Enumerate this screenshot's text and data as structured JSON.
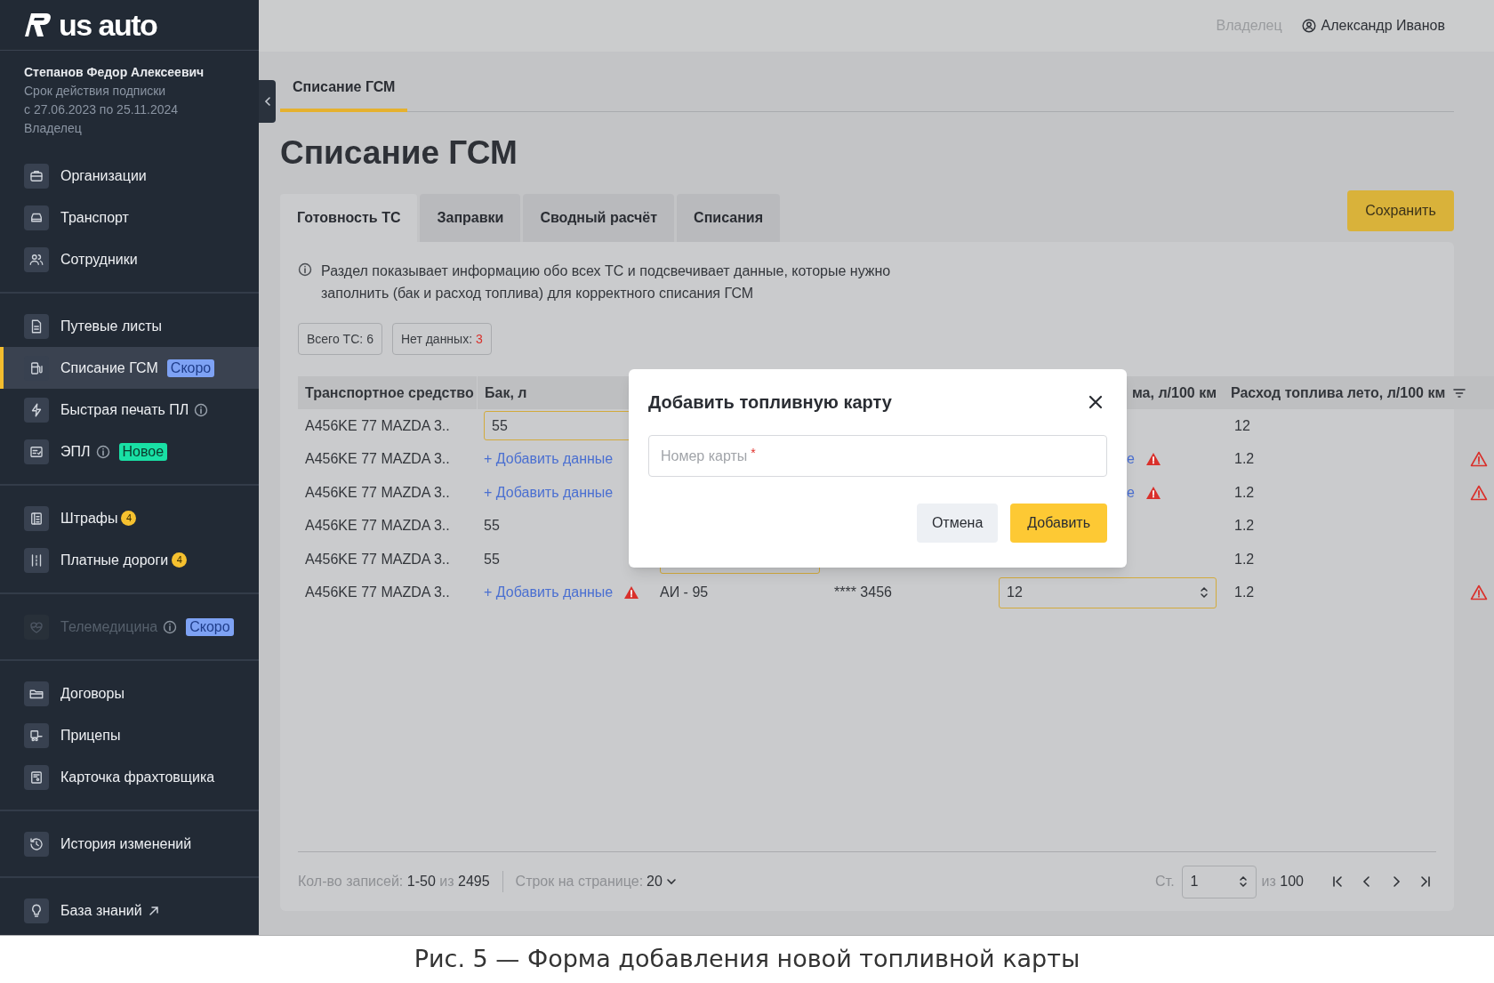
{
  "logo": {
    "text": "us auto"
  },
  "profile": {
    "name": "Степанов Федор Алексеевич",
    "subscription_label": "Срок действия подписки",
    "subscription_period": "с 27.06.2023 по 25.11.2024",
    "role": "Владелец"
  },
  "nav": [
    {
      "items": [
        {
          "label": "Организации",
          "selected": false,
          "disabled": false
        },
        {
          "label": "Транспорт",
          "selected": false,
          "disabled": false
        },
        {
          "label": "Сотрудники",
          "selected": false,
          "disabled": false
        }
      ]
    },
    {
      "items": [
        {
          "label": "Путевые листы",
          "selected": false,
          "disabled": false
        },
        {
          "label": "Списание ГСМ",
          "selected": true,
          "disabled": false,
          "badge": {
            "kind": "soon",
            "text": "Скоро"
          }
        },
        {
          "label": "Быстрая печать ПЛ",
          "selected": false,
          "disabled": false,
          "info": true
        },
        {
          "label": "ЭПЛ",
          "selected": false,
          "disabled": false,
          "info": true,
          "badge": {
            "kind": "new",
            "text": "Новое"
          }
        }
      ]
    },
    {
      "items": [
        {
          "label": "Штрафы",
          "selected": false,
          "disabled": false,
          "badge": {
            "kind": "count",
            "text": "4"
          }
        },
        {
          "label": "Платные дороги",
          "selected": false,
          "disabled": false,
          "badge": {
            "kind": "count",
            "text": "4"
          }
        }
      ]
    },
    {
      "items": [
        {
          "label": "Телемедицина",
          "selected": false,
          "disabled": true,
          "info": true,
          "badge": {
            "kind": "soon",
            "text": "Скоро"
          }
        }
      ]
    },
    {
      "items": [
        {
          "label": "Договоры",
          "selected": false,
          "disabled": false
        },
        {
          "label": "Прицепы",
          "selected": false,
          "disabled": false
        },
        {
          "label": "Карточка фрахтовщика",
          "selected": false,
          "disabled": false
        }
      ]
    },
    {
      "items": [
        {
          "label": "История изменений",
          "selected": false,
          "disabled": false
        }
      ]
    },
    {
      "items": [
        {
          "label": "База знаний",
          "selected": false,
          "disabled": false,
          "external": true
        }
      ]
    }
  ],
  "header": {
    "role": "Владелец",
    "user": "Александр Иванов"
  },
  "page_tabs": [
    {
      "label": "Списание ГСМ",
      "selected": true
    }
  ],
  "title": "Списание ГСМ",
  "tabs": [
    {
      "label": "Готовность ТС",
      "selected": true
    },
    {
      "label": "Заправки",
      "selected": false
    },
    {
      "label": "Сводный расчёт",
      "selected": false
    },
    {
      "label": "Списания",
      "selected": false
    }
  ],
  "save_button": "Сохранить",
  "info": "Раздел показывает информацию обо всех ТС и подсвечивает данные, которые нужно заполнить (бак и расход топлива) для корректного списания ГСМ",
  "chips": [
    {
      "label": "Всего ТС:",
      "value": "6",
      "alert": false
    },
    {
      "label": "Нет данных:",
      "value": "3",
      "alert": true
    }
  ],
  "table": {
    "columns": [
      {
        "label": "Транспортное средство"
      },
      {
        "label": "Бак, л"
      },
      {
        "label": "ма, л/100 км"
      },
      {
        "label": "Расход топлива лето, л/100 км",
        "filter": true
      }
    ],
    "rows": [
      {
        "vehicle": "A456KE 77 MAZDA 3..",
        "tank": {
          "kind": "input",
          "text": "55",
          "warning": false
        },
        "summer": "12",
        "alert": false
      },
      {
        "vehicle": "A456KE 77 MAZDA 3..",
        "tank": {
          "kind": "link",
          "text": "+ Добавить данные",
          "warning": false
        },
        "winter": {
          "kind": "link",
          "text": "е",
          "warning": true
        },
        "summer": "1.2",
        "alert": true
      },
      {
        "vehicle": "A456KE 77 MAZDA 3..",
        "tank": {
          "kind": "link",
          "text": "+ Добавить данные",
          "warning": false
        },
        "winter": {
          "kind": "link",
          "text": "е",
          "warning": true
        },
        "summer": "1.2",
        "alert": true
      },
      {
        "vehicle": "A456KE 77 MAZDA 3..",
        "tank": {
          "kind": "text",
          "text": "55",
          "warning": false
        },
        "summer": "1.2",
        "alert": false
      },
      {
        "vehicle": "A456KE 77 MAZDA 3..",
        "tank": {
          "kind": "text",
          "text": "55",
          "warning": false
        },
        "fuel": {
          "kind": "input"
        },
        "summer": "1.2",
        "alert": false
      },
      {
        "vehicle": "A456KE 77 MAZDA 3..",
        "tank": {
          "kind": "link",
          "text": "+ Добавить данные",
          "warning": true
        },
        "fuel": {
          "kind": "text",
          "text": "АИ - 95"
        },
        "card": "**** 3456",
        "winter": {
          "kind": "spinner",
          "text": "12",
          "warning": false
        },
        "summer": "1.2",
        "alert": true
      }
    ]
  },
  "footer": {
    "records_label": "Кол-во записей:",
    "records_range": "1-50",
    "records_of": "из",
    "records_total": "2495",
    "per_page_label": "Строк на странице:",
    "per_page": "20",
    "page_label": "Ст.",
    "page": "1",
    "pages_of": "из",
    "pages_total": "100"
  },
  "modal": {
    "title": "Добавить топливную карту",
    "field": {
      "placeholder": "Номер карты",
      "required_mark": "*"
    },
    "cancel": "Отмена",
    "confirm": "Добавить"
  },
  "caption": "Рис. 5 — Форма добавления новой топливной карты"
}
